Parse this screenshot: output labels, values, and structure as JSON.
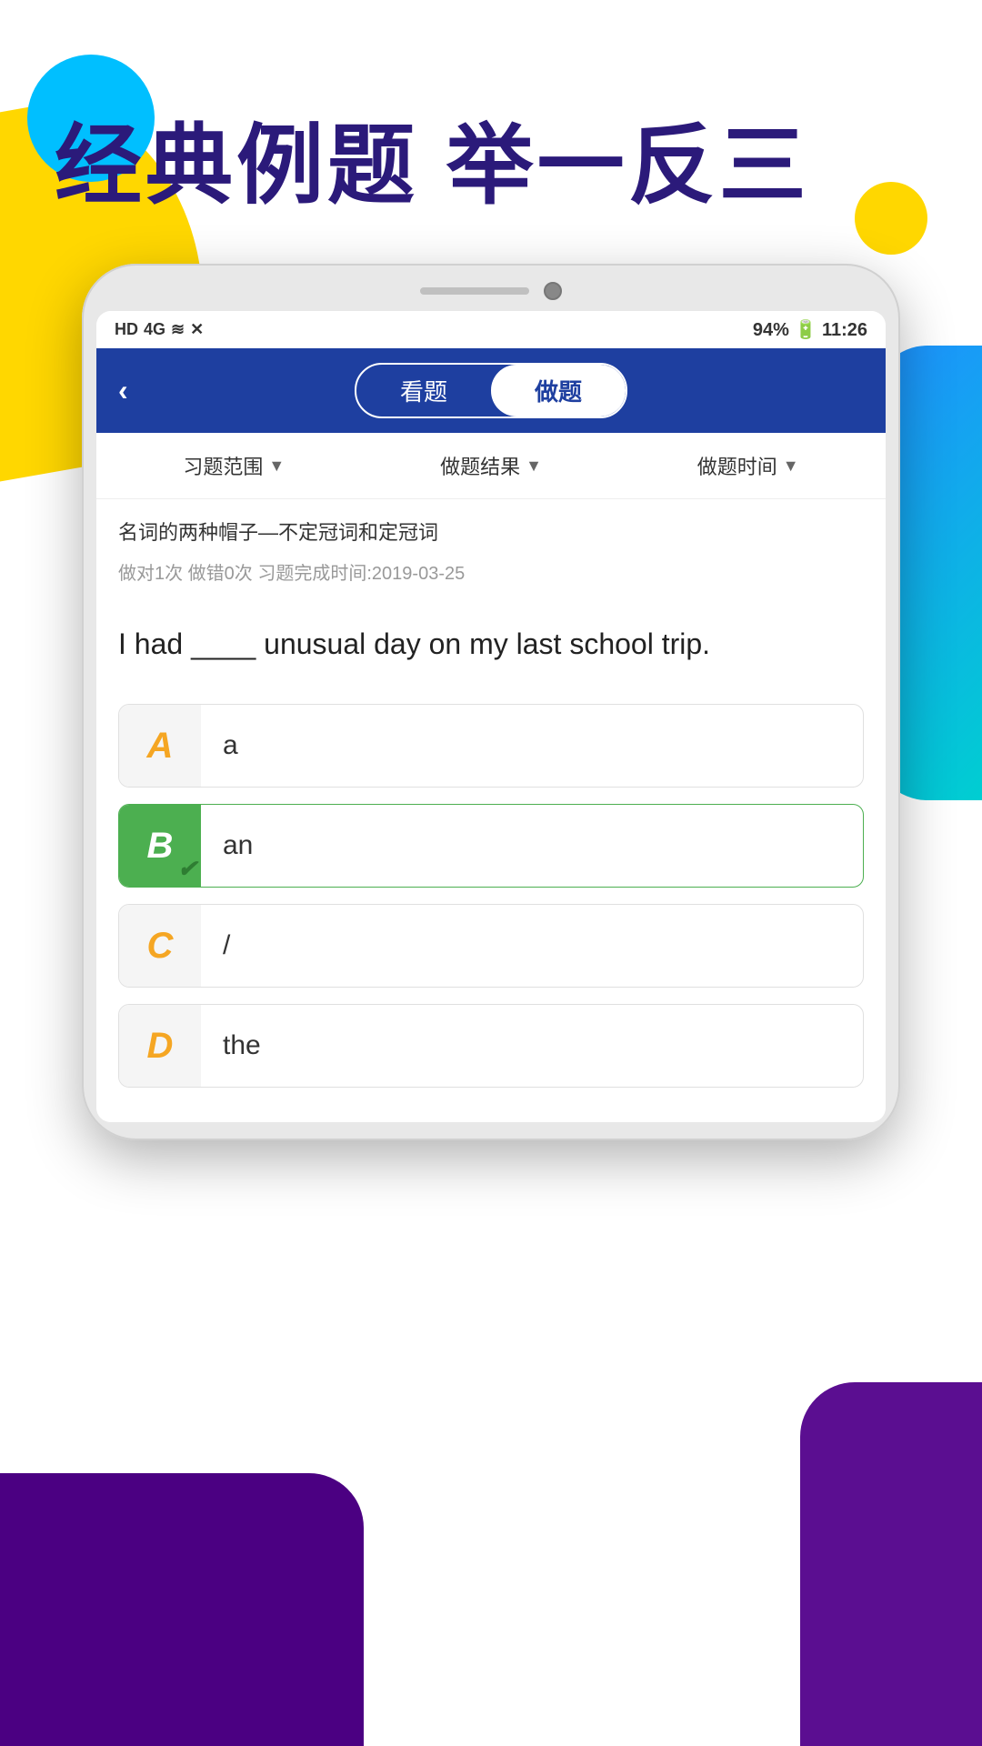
{
  "app": {
    "hero_text": "经典例题  举一反三",
    "status_bar": {
      "left_icons": "HD 4G  ⊿ ≋ ✕",
      "battery": "94%",
      "time": "11:26"
    },
    "header": {
      "back_label": "‹",
      "tab_view_label": "看题",
      "tab_do_label": "做题",
      "active_tab": "做题"
    },
    "filters": [
      {
        "label": "习题范围",
        "arrow": "▼"
      },
      {
        "label": "做题结果",
        "arrow": "▼"
      },
      {
        "label": "做题时间",
        "arrow": "▼"
      }
    ],
    "question": {
      "category": "名词的两种帽子—不定冠词和定冠词",
      "meta": "做对1次  做错0次  习题完成时间:2019-03-25",
      "text": "I had ____ unusual day on my last school trip.",
      "options": [
        {
          "letter": "A",
          "text": "a",
          "style": "yellow",
          "correct": false
        },
        {
          "letter": "B",
          "text": "an",
          "style": "green-bg",
          "correct": true,
          "has_check": true
        },
        {
          "letter": "C",
          "text": "/",
          "style": "orange",
          "correct": false
        },
        {
          "letter": "D",
          "text": "the",
          "style": "gold",
          "correct": false
        }
      ]
    }
  }
}
